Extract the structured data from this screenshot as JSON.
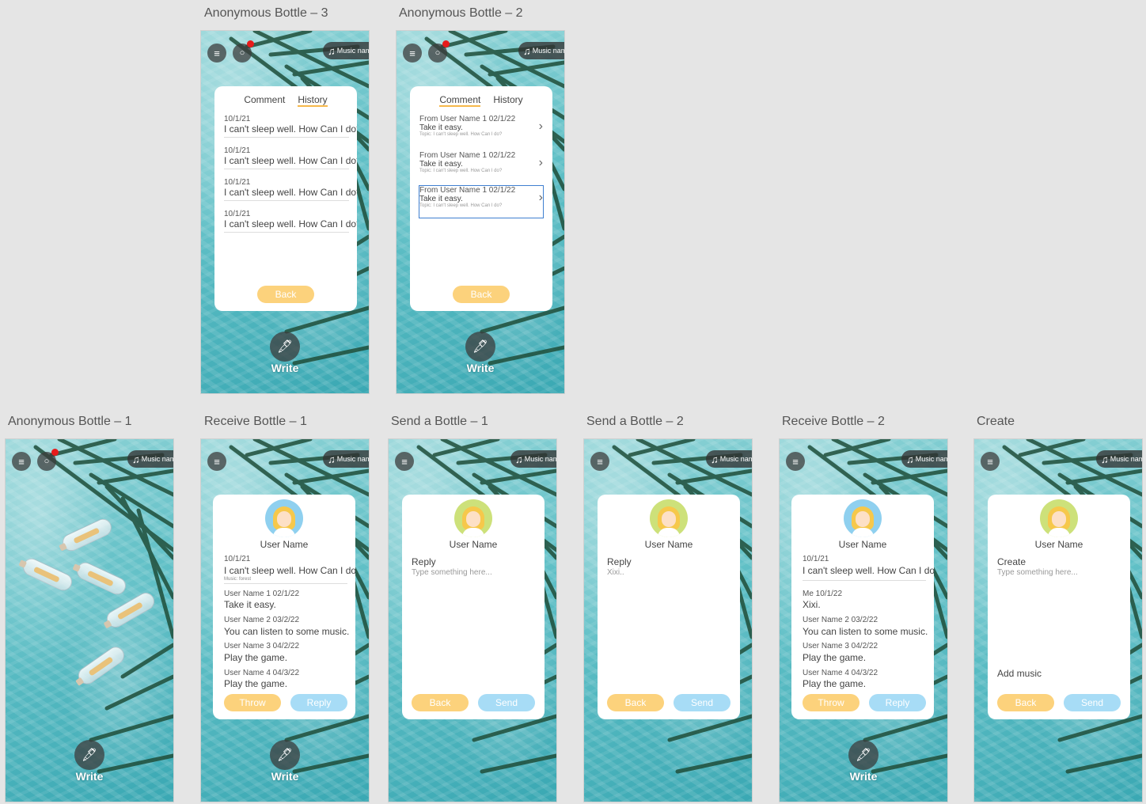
{
  "common": {
    "music_label": "Music name",
    "write_label": "Write",
    "menu_glyph": "≡",
    "chat_glyph": "○",
    "music_glyph": "♫",
    "write_glyph": "🖋"
  },
  "ab3": {
    "title": "Anonymous Bottle – 3",
    "tabs": [
      "Comment",
      "History"
    ],
    "items": [
      {
        "date": "10/1/21",
        "text": "I can't sleep well. How Can I do?"
      },
      {
        "date": "10/1/21",
        "text": "I can't sleep well. How Can I do?"
      },
      {
        "date": "10/1/21",
        "text": "I can't sleep well. How Can I do?"
      },
      {
        "date": "10/1/21",
        "text": "I can't sleep well. How Can I do?"
      }
    ],
    "back": "Back"
  },
  "ab2": {
    "title": "Anonymous Bottle – 2",
    "tabs": [
      "Comment",
      "History"
    ],
    "items": [
      {
        "from": "From User Name 1 02/1/22",
        "text": "Take it easy.",
        "topic": "Topic: I can't sleep well. How Can I do?"
      },
      {
        "from": "From User Name 1 02/1/22",
        "text": "Take it easy.",
        "topic": "Topic: I can't sleep well. How Can I do?"
      },
      {
        "from": "From User Name 1 02/1/22",
        "text": "Take it easy.",
        "topic": "Topic: I can't sleep well. How Can I do?"
      }
    ],
    "back": "Back"
  },
  "ab1": {
    "title": "Anonymous Bottle – 1"
  },
  "rb1": {
    "title": "Receive Bottle – 1",
    "user": "User Name",
    "date": "10/1/21",
    "text": "I can't sleep well. How Can I do?",
    "music": "Music: forest",
    "replies": [
      {
        "head": "User Name 1 02/1/22",
        "text": "Take it easy."
      },
      {
        "head": "User Name 2 03/2/22",
        "text": "You can listen to some music."
      },
      {
        "head": "User Name 3 04/2/22",
        "text": "Play the game."
      },
      {
        "head": "User Name 4 04/3/22",
        "text": "Play the game."
      }
    ],
    "throw": "Throw",
    "reply": "Reply"
  },
  "sb1": {
    "title": "Send a Bottle – 1",
    "user": "User Name",
    "label": "Reply",
    "placeholder": "Type something here...",
    "back": "Back",
    "send": "Send"
  },
  "sb2": {
    "title": "Send a Bottle – 2",
    "user": "User Name",
    "label": "Reply",
    "value": "Xixi..",
    "back": "Back",
    "send": "Send"
  },
  "rb2": {
    "title": "Receive Bottle – 2",
    "user": "User Name",
    "date": "10/1/21",
    "text": "I can't sleep well. How Can I do?",
    "replies": [
      {
        "head": "Me 10/1/22",
        "text": "Xixi."
      },
      {
        "head": "User Name 2 03/2/22",
        "text": "You can listen to some music."
      },
      {
        "head": "User Name 3 04/2/22",
        "text": "Play the game."
      },
      {
        "head": "User Name 4 04/3/22",
        "text": "Play the game."
      }
    ],
    "throw": "Throw",
    "reply": "Reply"
  },
  "cr": {
    "title": "Create",
    "user": "User Name",
    "label": "Create",
    "placeholder": "Type something here...",
    "add_music": "Add music",
    "back": "Back",
    "send": "Send"
  }
}
